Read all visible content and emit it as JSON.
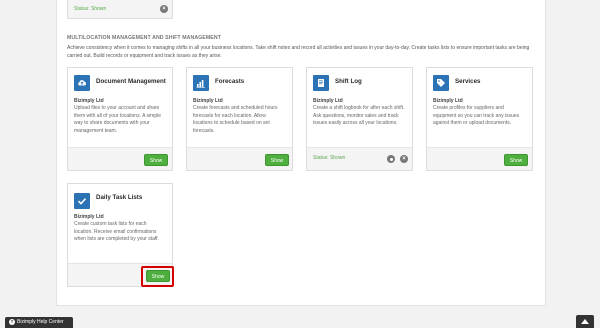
{
  "top_card": {
    "status": "Status: Shown"
  },
  "section": {
    "title": "MULTILOCATION MANAGEMENT AND SHIFT MANAGEMENT",
    "description": "Achieve consistency when it comes to managing shifts in all your business locations. Take shift notes and record all activities and issues in your day-to-day. Create tasks lists to ensure important tasks are being carried out. Build records or equipment and track issues as they arise."
  },
  "cards": [
    {
      "title": "Document Management",
      "company": "Bizimply Ltd",
      "description": "Upload files to your account and share them with all of your locations. A simple way to share documents with your management team.",
      "button": "Show",
      "icon": "cloud-upload-icon"
    },
    {
      "title": "Forecasts",
      "company": "Bizimply Ltd",
      "description": "Create forecasts and scheduled hours forecasts for each location. Allow locations to schedule based on set forecasts.",
      "button": "Show",
      "icon": "bar-chart-icon"
    },
    {
      "title": "Shift Log",
      "company": "Bizimply Ltd",
      "description": "Create a shift logbook for after each shift. Ask questions, monitor sales and track issues easily across all your locations.",
      "status": "Status: Shown",
      "icon": "book-icon"
    },
    {
      "title": "Services",
      "company": "Bizimply Ltd",
      "description": "Create profiles for suppliers and equipment so you can track any issues against them or upload documents.",
      "button": "Show",
      "icon": "tag-icon"
    },
    {
      "title": "Daily Task Lists",
      "company": "Bizimply Ltd",
      "description": "Create custom task lists for each location. Receive email confirmations when lists are completed by your staff.",
      "button": "Show",
      "icon": "checkmark-icon"
    }
  ],
  "footer": {
    "help_label": "Bizimply Help Center"
  },
  "colors": {
    "accent": "#2c73b6",
    "show_button": "#4eae3e",
    "highlight": "#d40000"
  }
}
